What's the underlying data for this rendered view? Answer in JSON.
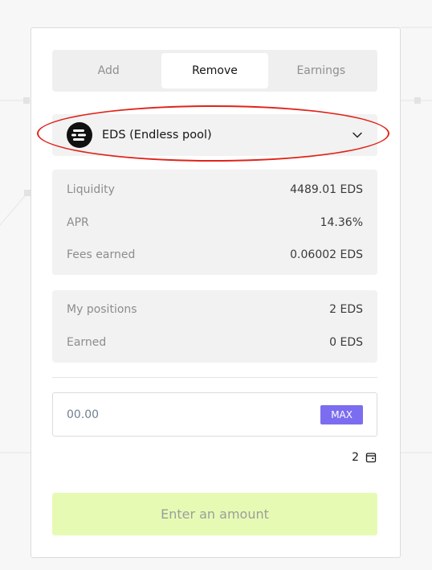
{
  "tabs": [
    {
      "label": "Add",
      "active": false
    },
    {
      "label": "Remove",
      "active": true
    },
    {
      "label": "Earnings",
      "active": false
    }
  ],
  "pool": {
    "name": "EDS (Endless pool)",
    "icon": "eds-logo-icon"
  },
  "pool_stats": [
    {
      "label": "Liquidity",
      "value": "4489.01 EDS"
    },
    {
      "label": "APR",
      "value": "14.36%"
    },
    {
      "label": "Fees earned",
      "value": "0.06002 EDS"
    }
  ],
  "my_stats": [
    {
      "label": "My positions",
      "value": "2 EDS"
    },
    {
      "label": "Earned",
      "value": "0 EDS"
    }
  ],
  "amount": {
    "placeholder": "00.00",
    "max_label": "MAX"
  },
  "balance": {
    "value": "2",
    "icon": "wallet-icon"
  },
  "submit": {
    "label": "Enter an amount"
  },
  "colors": {
    "accent": "#7c6df0",
    "submit_bg": "#e7fab4",
    "highlight": "#e0241b"
  }
}
